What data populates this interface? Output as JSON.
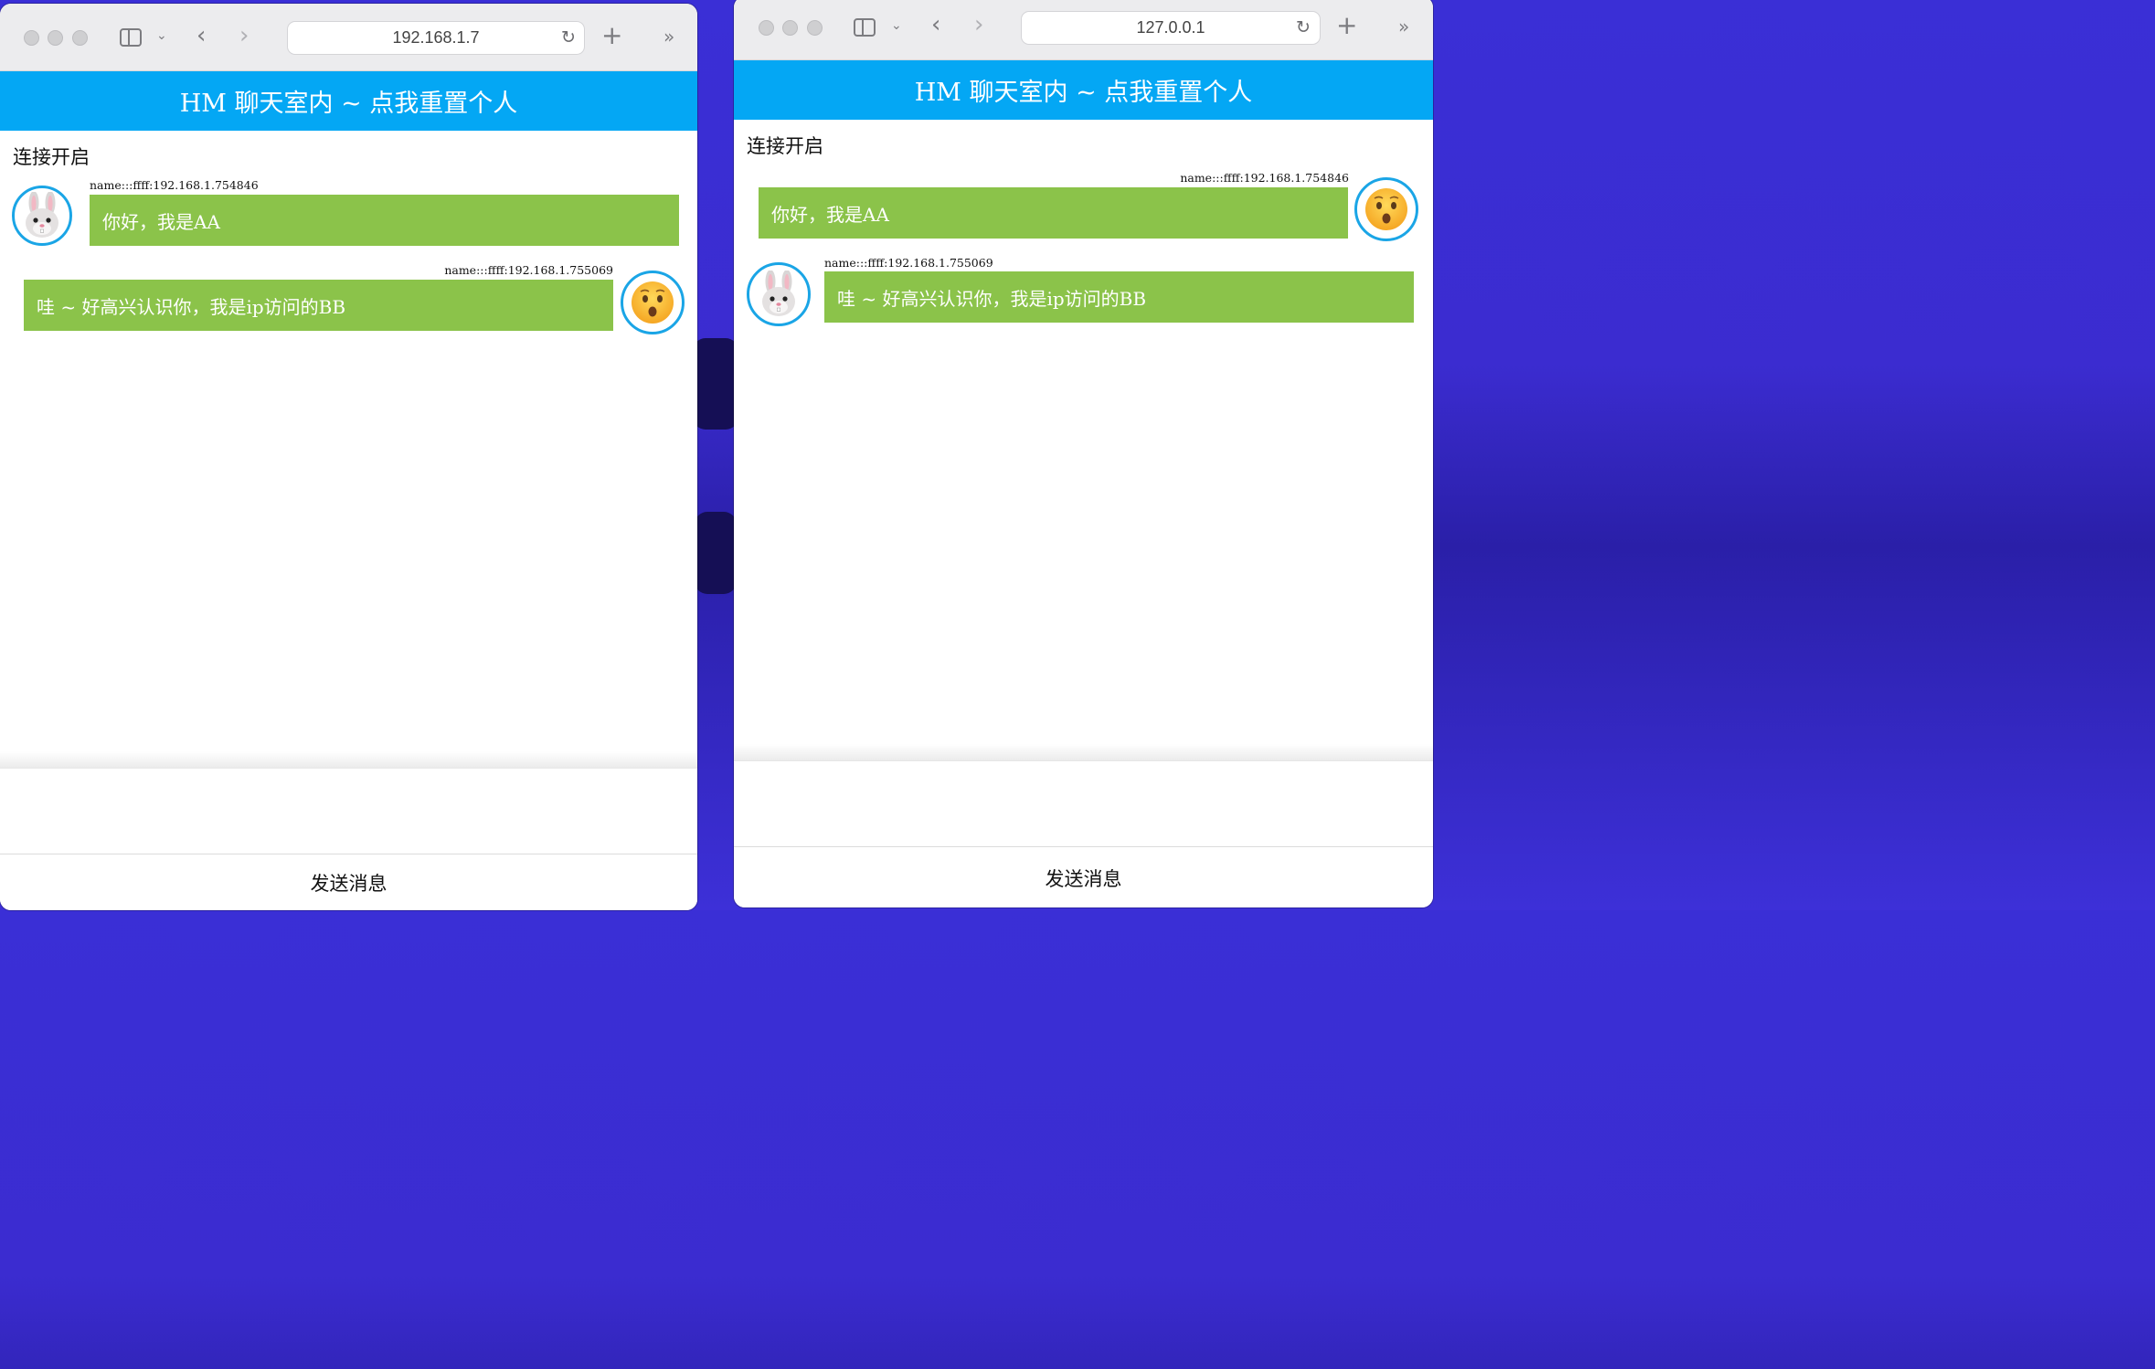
{
  "left_window": {
    "address": "192.168.1.7",
    "header_title": "HM 聊天室内 ~ 点我重置个人",
    "status": "连接开启",
    "messages": [
      {
        "name": "name:::ffff:192.168.1.754846",
        "text": "你好，我是AA",
        "side": "left",
        "avatar": "rabbit-icon"
      },
      {
        "name": "name:::ffff:192.168.1.755069",
        "text": "哇 ~ 好高兴认识你，我是ip访问的BB",
        "side": "right",
        "avatar": "hushed-face-icon"
      }
    ],
    "send_label": "发送消息"
  },
  "right_window": {
    "address": "127.0.0.1",
    "header_title": "HM 聊天室内 ~ 点我重置个人",
    "status": "连接开启",
    "messages": [
      {
        "name": "name:::ffff:192.168.1.754846",
        "text": "你好，我是AA",
        "side": "right",
        "avatar": "hushed-face-icon"
      },
      {
        "name": "name:::ffff:192.168.1.755069",
        "text": "哇 ~ 好高兴认识你，我是ip访问的BB",
        "side": "left",
        "avatar": "rabbit-icon"
      }
    ],
    "send_label": "发送消息"
  },
  "colors": {
    "header": "#04a7f4",
    "bubble": "#8bc34a",
    "avatar_border": "#1aa5e6",
    "desktop": "#3b2cd0"
  }
}
